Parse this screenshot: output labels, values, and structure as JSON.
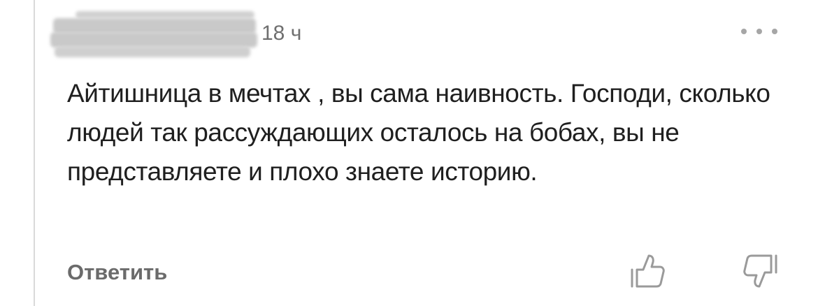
{
  "comment": {
    "timestamp": "18 ч",
    "text": "Айтишница в мечтах , вы сама наивность. Господи, сколько людей так рассуждающих осталось на бобах, вы не представляете и плохо знаете историю.",
    "reply_label": "Ответить"
  },
  "icons": {
    "more": "more-horizontal-icon",
    "like": "thumbs-up-icon",
    "dislike": "thumbs-down-icon"
  },
  "colors": {
    "text": "#1f1f1f",
    "muted": "#6f6f6f",
    "icon": "#9a9a9a",
    "thread_line": "#d9d9d9"
  }
}
